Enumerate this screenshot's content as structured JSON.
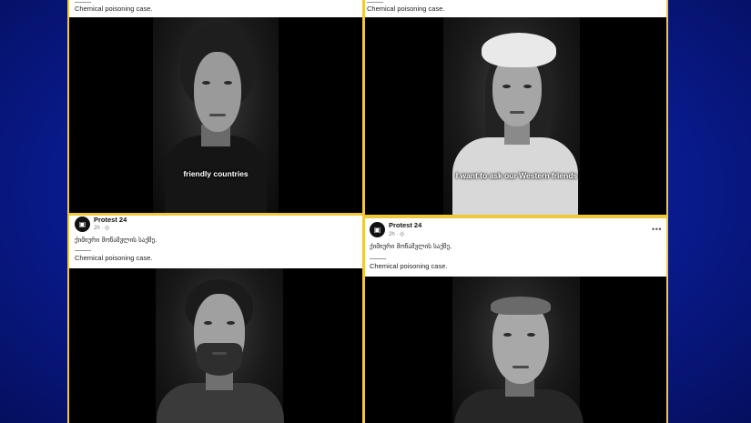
{
  "posts": [
    {
      "page_name": "",
      "time": "",
      "caption_ka": "",
      "caption_en": "Chemical poisoning case.",
      "subtitle": "friendly countries"
    },
    {
      "page_name": "",
      "time": "",
      "caption_ka": "",
      "caption_en": "Chemical poisoning case.",
      "subtitle": "I want to ask our Western friends"
    },
    {
      "page_name": "Protest 24",
      "time": "2h · ◎",
      "caption_ka": "ქიმიური მოწამვლის საქმე.",
      "caption_en": "Chemical poisoning case.",
      "subtitle": ""
    },
    {
      "page_name": "Protest 24",
      "time": "2h · ◎",
      "caption_ka": "ქიმიური მოწამვლის საქმე.",
      "caption_en": "Chemical poisoning case.",
      "subtitle": "",
      "more": "•••"
    }
  ],
  "avatar_glyph": "▣",
  "colors": {
    "background_blue": "#0a1d9a",
    "collage_border": "#f0c93a",
    "video_bg": "#000000"
  }
}
